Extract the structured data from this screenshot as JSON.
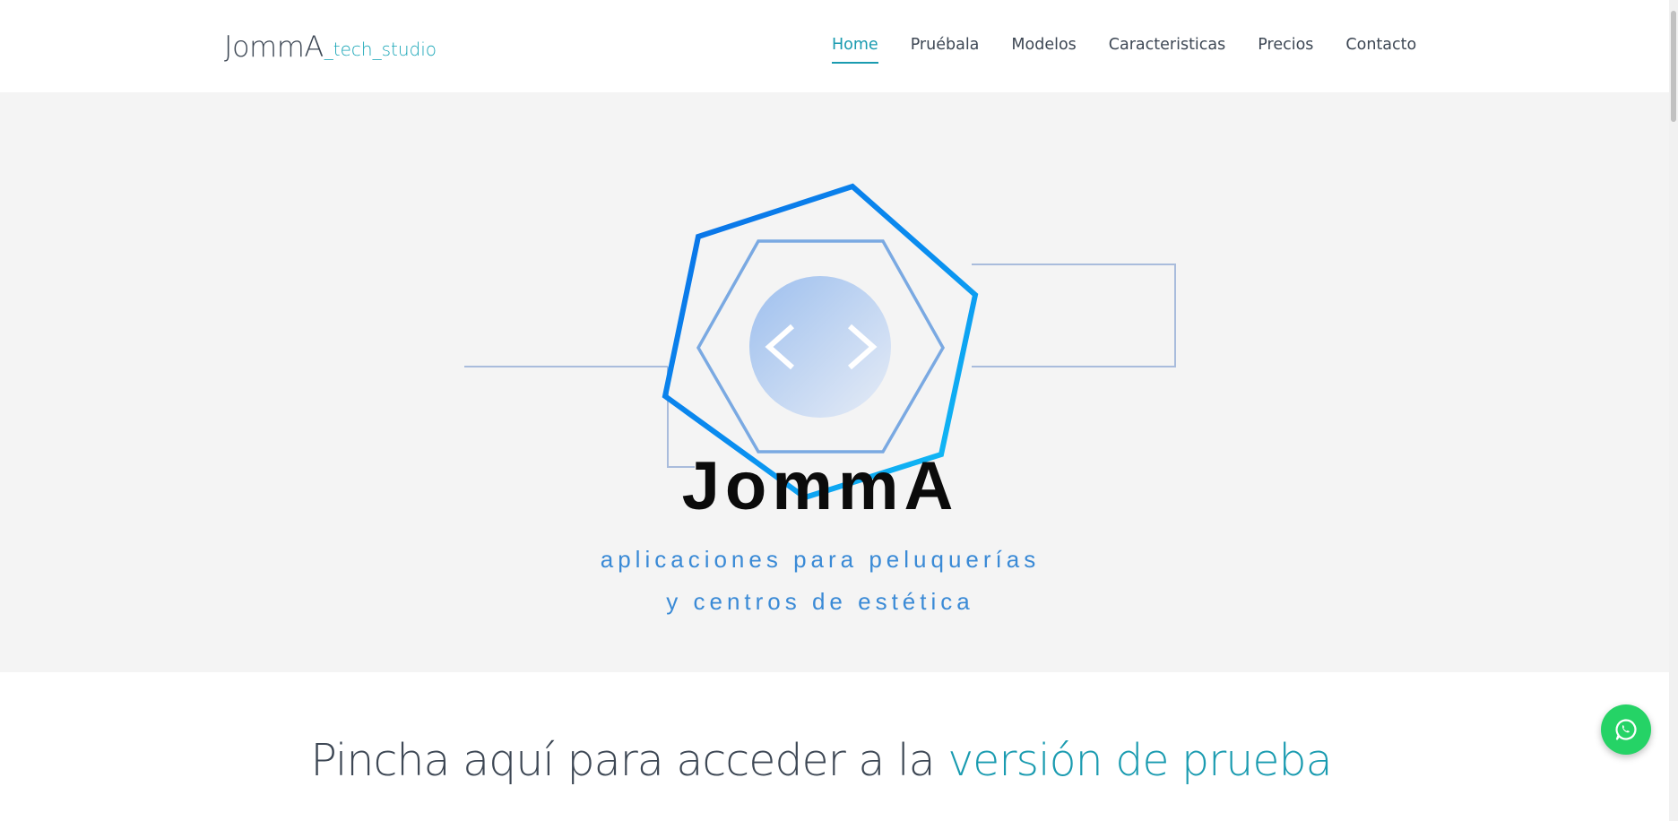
{
  "brand": {
    "logo_main": "JommA",
    "logo_sub": "_tech_studio"
  },
  "nav": {
    "items": [
      {
        "label": "Home",
        "active": true
      },
      {
        "label": "Pruébala",
        "active": false
      },
      {
        "label": "Modelos",
        "active": false
      },
      {
        "label": "Caracteristicas",
        "active": false
      },
      {
        "label": "Precios",
        "active": false
      },
      {
        "label": "Contacto",
        "active": false
      }
    ]
  },
  "hero": {
    "title": "JommA",
    "tagline_line1": "aplicaciones para peluquerías",
    "tagline_line2": "y centros de estética",
    "code_symbol_left": "<",
    "code_symbol_right": ">"
  },
  "cta": {
    "text_prefix": "Pincha aquí para acceder a la ",
    "text_link": "versión de prueba"
  },
  "whatsapp": {
    "icon": "whatsapp-icon"
  },
  "colors": {
    "accent": "#1a9bb0",
    "text": "#3d4754",
    "hero_bg": "#f4f4f4",
    "tagline": "#3a8ad6",
    "whatsapp": "#25d366"
  }
}
